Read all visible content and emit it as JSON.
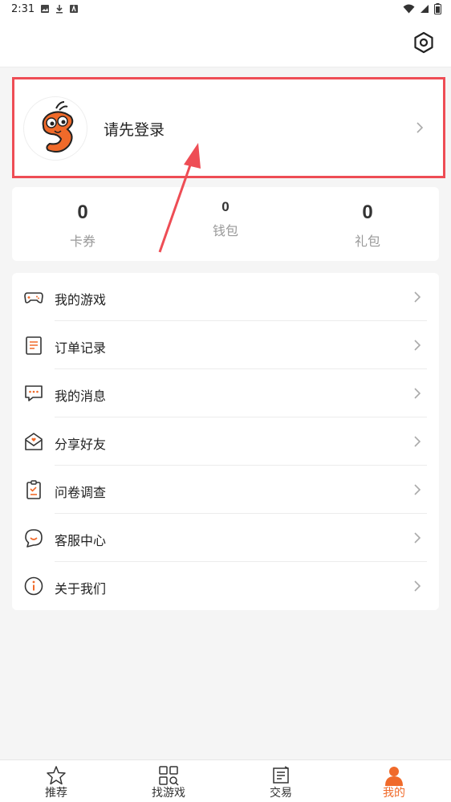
{
  "status_bar": {
    "time": "2:31"
  },
  "header": {
    "settings_icon": "gear-hex-icon"
  },
  "login": {
    "prompt": "请先登录",
    "avatar_icon": "shrimp-mascot-avatar"
  },
  "stats": [
    {
      "value": "0",
      "label": "卡券"
    },
    {
      "value": "0",
      "label": "钱包"
    },
    {
      "value": "0",
      "label": "礼包"
    }
  ],
  "menu": [
    {
      "label": "我的游戏",
      "icon": "gamepad-icon"
    },
    {
      "label": "订单记录",
      "icon": "order-list-icon"
    },
    {
      "label": "我的消息",
      "icon": "message-icon"
    },
    {
      "label": "分享好友",
      "icon": "share-envelope-icon"
    },
    {
      "label": "问卷调查",
      "icon": "survey-clipboard-icon"
    },
    {
      "label": "客服中心",
      "icon": "customer-service-icon"
    },
    {
      "label": "关于我们",
      "icon": "info-icon"
    }
  ],
  "bottom_nav": [
    {
      "label": "推荐",
      "icon": "star-icon"
    },
    {
      "label": "找游戏",
      "icon": "grid-search-icon"
    },
    {
      "label": "交易",
      "icon": "trade-icon"
    },
    {
      "label": "我的",
      "icon": "person-icon",
      "active": true
    }
  ],
  "colors": {
    "accent": "#f06a2a",
    "highlight_border": "#ee4d55",
    "annotation_arrow": "#ee4d55"
  }
}
